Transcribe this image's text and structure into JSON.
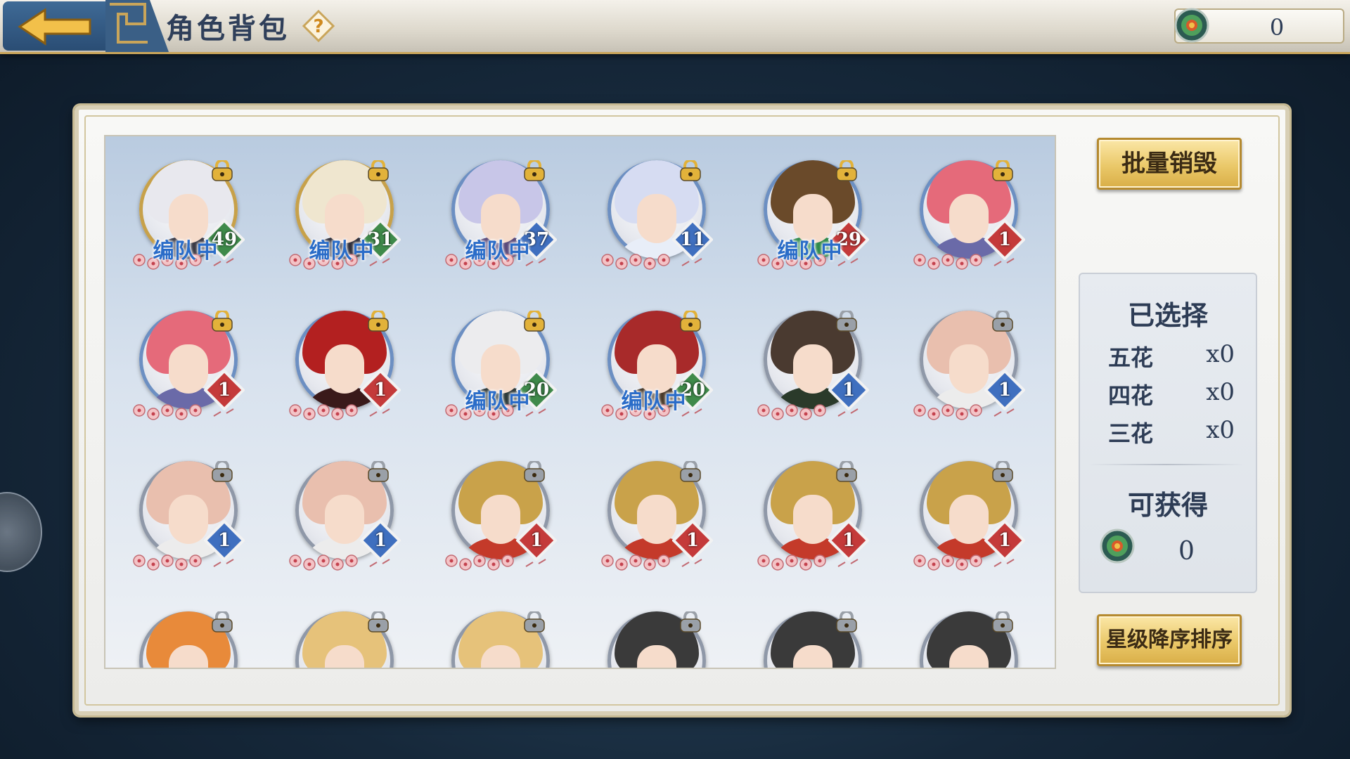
{
  "header": {
    "title": "角色背包",
    "help_icon": "question-mark-icon",
    "currency_value": "0"
  },
  "roster": [
    {
      "level": "49",
      "team": "编队中",
      "rarity": "gold",
      "hair": "#e8e8ee",
      "cloth": "#3a3a46",
      "lock": "gold",
      "badge": "#3f8a4a"
    },
    {
      "level": "31",
      "team": "编队中",
      "rarity": "gold",
      "hair": "#efe6cf",
      "cloth": "#2e2e3a",
      "lock": "gold",
      "badge": "#3f8a4a"
    },
    {
      "level": "37",
      "team": "编队中",
      "rarity": "blue",
      "hair": "#c8c6e8",
      "cloth": "#5a4a7a",
      "lock": "gold",
      "badge": "#3f6fbf"
    },
    {
      "level": "11",
      "team": "",
      "rarity": "blue",
      "hair": "#d6dcf2",
      "cloth": "#e8eef8",
      "lock": "gold",
      "badge": "#3f6fbf"
    },
    {
      "level": "29",
      "team": "编队中",
      "rarity": "blue",
      "hair": "#6a4a2a",
      "cloth": "#2f8a4a",
      "lock": "gold",
      "badge": "#c43a3a"
    },
    {
      "level": "1",
      "team": "",
      "rarity": "blue",
      "hair": "#e56a7a",
      "cloth": "#6a6aa8",
      "lock": "gold",
      "badge": "#c43a3a"
    },
    {
      "level": "1",
      "team": "",
      "rarity": "blue",
      "hair": "#e56a7a",
      "cloth": "#6a6aa8",
      "lock": "gold",
      "badge": "#c43a3a"
    },
    {
      "level": "1",
      "team": "",
      "rarity": "blue",
      "hair": "#b32020",
      "cloth": "#3a1a1a",
      "lock": "gold",
      "badge": "#c43a3a"
    },
    {
      "level": "20",
      "team": "编队中",
      "rarity": "blue",
      "hair": "#ececee",
      "cloth": "#2e3a3a",
      "lock": "gold",
      "badge": "#3f8a4a"
    },
    {
      "level": "20",
      "team": "编队中",
      "rarity": "blue",
      "hair": "#a82a2a",
      "cloth": "#4a3a2a",
      "lock": "gold",
      "badge": "#3f8a4a"
    },
    {
      "level": "1",
      "team": "",
      "rarity": "grey",
      "hair": "#4a3a30",
      "cloth": "#2a3a2a",
      "lock": "grey",
      "badge": "#3f6fbf"
    },
    {
      "level": "1",
      "team": "",
      "rarity": "grey",
      "hair": "#e9bfae",
      "cloth": "#ececec",
      "lock": "grey",
      "badge": "#3f6fbf"
    },
    {
      "level": "1",
      "team": "",
      "rarity": "grey",
      "hair": "#e9bfae",
      "cloth": "#ececec",
      "lock": "grey",
      "badge": "#3f6fbf"
    },
    {
      "level": "1",
      "team": "",
      "rarity": "grey",
      "hair": "#e9bfae",
      "cloth": "#ececec",
      "lock": "grey",
      "badge": "#3f6fbf"
    },
    {
      "level": "1",
      "team": "",
      "rarity": "grey",
      "hair": "#c9a24a",
      "cloth": "#c43a2a",
      "lock": "grey",
      "badge": "#c43a3a"
    },
    {
      "level": "1",
      "team": "",
      "rarity": "grey",
      "hair": "#c9a24a",
      "cloth": "#c43a2a",
      "lock": "grey",
      "badge": "#c43a3a"
    },
    {
      "level": "1",
      "team": "",
      "rarity": "grey",
      "hair": "#c9a24a",
      "cloth": "#c43a2a",
      "lock": "grey",
      "badge": "#c43a3a"
    },
    {
      "level": "1",
      "team": "",
      "rarity": "grey",
      "hair": "#c9a24a",
      "cloth": "#c43a2a",
      "lock": "grey",
      "badge": "#c43a3a"
    },
    {
      "level": "",
      "team": "",
      "rarity": "grey",
      "hair": "#e88a3a",
      "cloth": "#ffffff",
      "lock": "grey",
      "badge": ""
    },
    {
      "level": "",
      "team": "",
      "rarity": "grey",
      "hair": "#e6c27a",
      "cloth": "#ffffff",
      "lock": "grey",
      "badge": ""
    },
    {
      "level": "",
      "team": "",
      "rarity": "grey",
      "hair": "#e6c27a",
      "cloth": "#ffffff",
      "lock": "grey",
      "badge": ""
    },
    {
      "level": "",
      "team": "",
      "rarity": "grey",
      "hair": "#3a3a3a",
      "cloth": "#ffffff",
      "lock": "grey",
      "badge": ""
    },
    {
      "level": "",
      "team": "",
      "rarity": "grey",
      "hair": "#3a3a3a",
      "cloth": "#ffffff",
      "lock": "grey",
      "badge": ""
    },
    {
      "level": "",
      "team": "",
      "rarity": "grey",
      "hair": "#3a3a3a",
      "cloth": "#ffffff",
      "lock": "grey",
      "badge": ""
    }
  ],
  "side": {
    "batch_destroy_label": "批量销毁",
    "selected_title": "已选择",
    "counts": [
      {
        "label": "五花",
        "value": "x0"
      },
      {
        "label": "四花",
        "value": "x0"
      },
      {
        "label": "三花",
        "value": "x0"
      }
    ],
    "obtainable_title": "可获得",
    "obtainable_value": "0",
    "sort_label": "星级降序排序"
  },
  "colors": {
    "accent_gold": "#eac869",
    "title_navy": "#2f3f5a",
    "team_blue": "#2a6cc8"
  }
}
